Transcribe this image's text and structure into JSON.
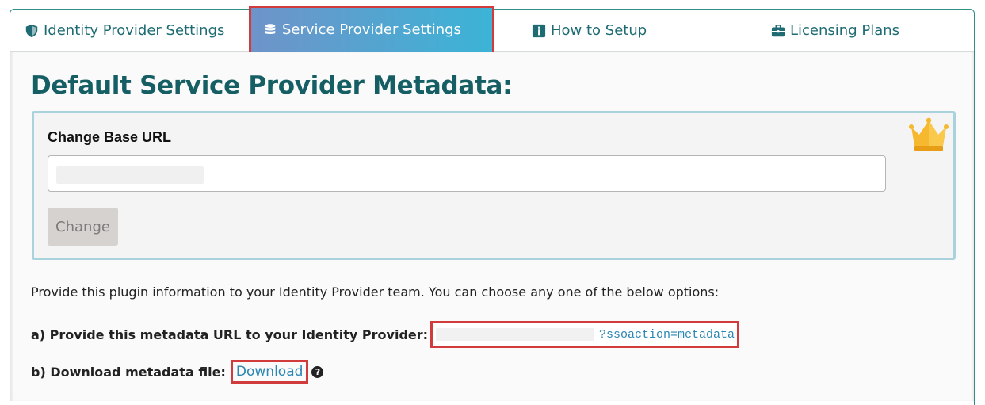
{
  "tabs": {
    "idp": {
      "label": "Identity Provider Settings",
      "icon": "shield-icon"
    },
    "sp": {
      "label": "Service Provider Settings",
      "icon": "database-icon"
    },
    "howto": {
      "label": "How to Setup",
      "icon": "info-icon"
    },
    "licensing": {
      "label": "Licensing Plans",
      "icon": "briefcase-icon"
    }
  },
  "main": {
    "title": "Default Service Provider Metadata:",
    "base_url": {
      "label": "Change Base URL",
      "value": "",
      "button_label": "Change",
      "badge_icon": "crown-icon"
    },
    "info_text": "Provide this plugin information to your Identity Provider team. You can choose any one of the below options:",
    "option_a": {
      "label": "a) Provide this metadata URL to your Identity Provider:",
      "url_suffix": "?ssoaction=metadata"
    },
    "option_b": {
      "label": "b) Download metadata file:",
      "link_label": "Download",
      "help_icon": "question-circle-icon"
    }
  },
  "colors": {
    "accent": "#155e63",
    "tab_text": "#1e6b74",
    "highlight": "#d23b3b",
    "link": "#2b86b3",
    "crown": "#f5b82e"
  }
}
